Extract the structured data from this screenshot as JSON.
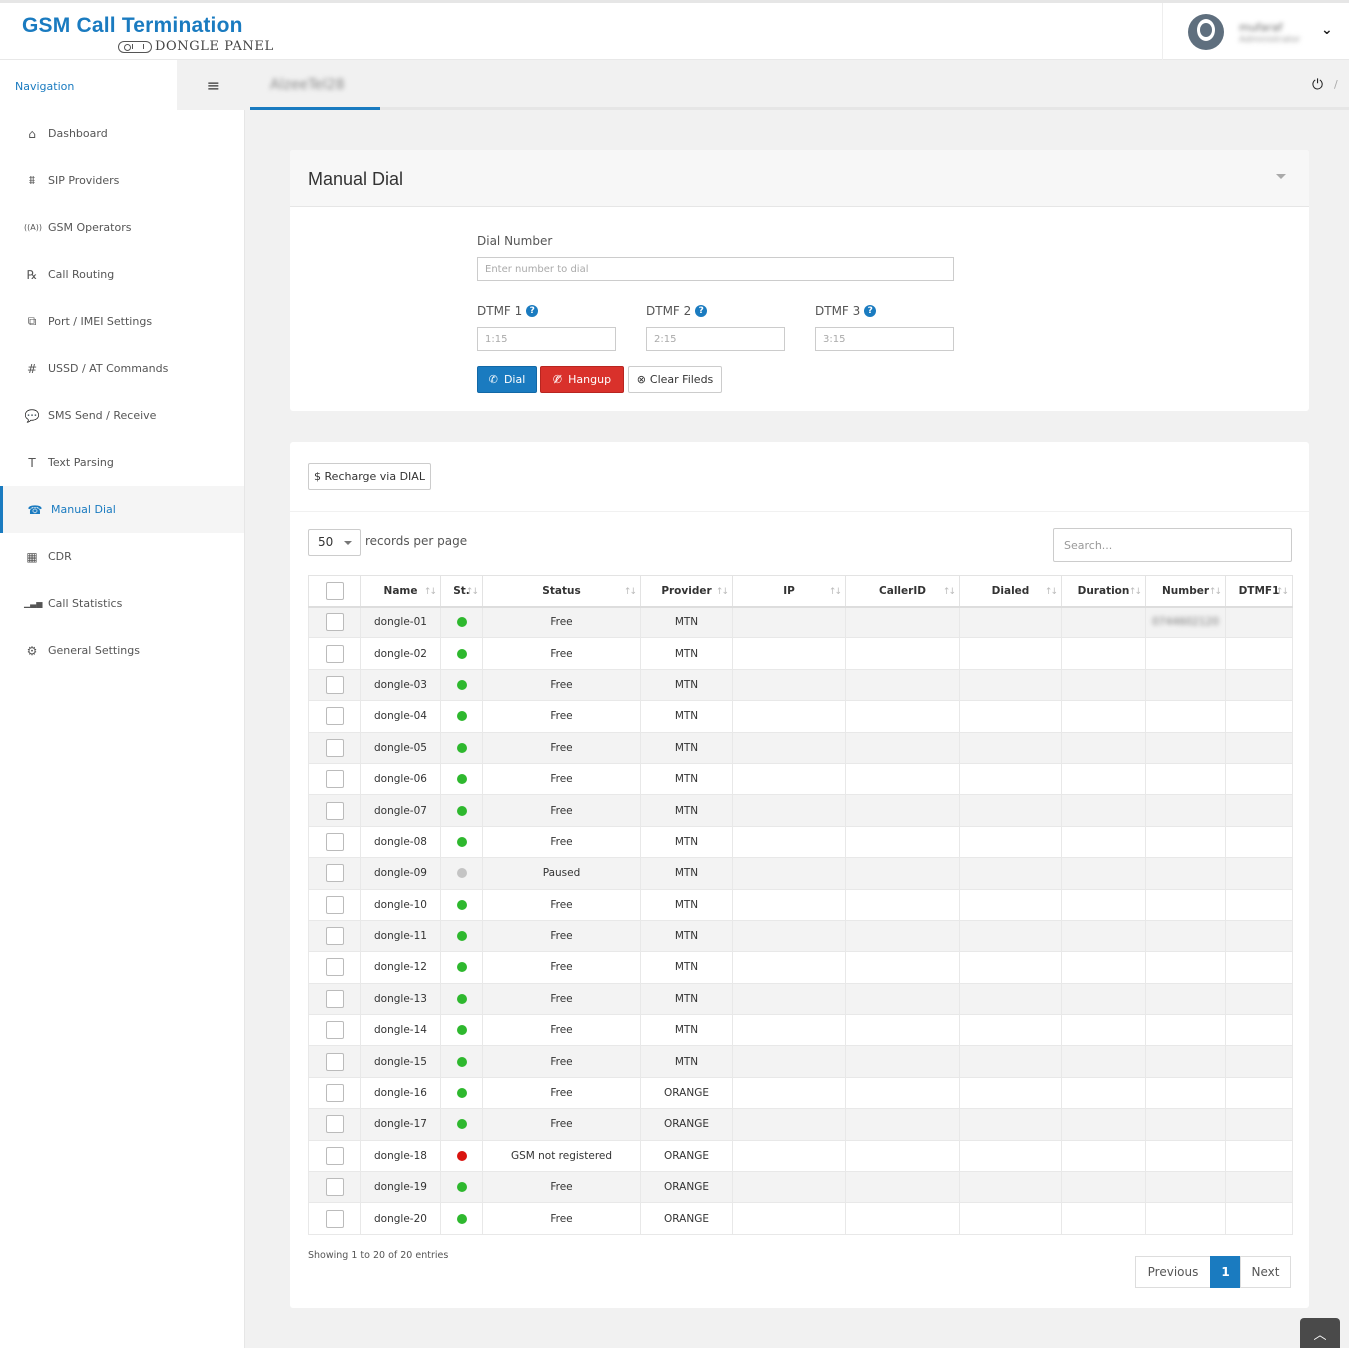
{
  "header": {
    "logo_title": "GSM Call Termination",
    "logo_sub": "DONGLE PANEL",
    "user_name": "mufaraf",
    "user_role": "Administrator",
    "caret_icon": "chevron-down-icon"
  },
  "nav": {
    "label": "Navigation",
    "toggle": "≡",
    "items": [
      {
        "label": "Dashboard",
        "icon": "⌂",
        "icon_name": "home-icon"
      },
      {
        "label": "SIP Providers",
        "icon": "⩩",
        "icon_name": "sitemap-icon"
      },
      {
        "label": "GSM Operators",
        "icon": "((A))",
        "icon_name": "antenna-icon"
      },
      {
        "label": "Call Routing",
        "icon": "℞",
        "icon_name": "prescription-icon"
      },
      {
        "label": "Port / IMEI Settings",
        "icon": "⧉",
        "icon_name": "network-icon"
      },
      {
        "label": "USSD / AT Commands",
        "icon": "#",
        "icon_name": "hash-icon"
      },
      {
        "label": "SMS Send / Receive",
        "icon": "💬",
        "icon_name": "sms-icon"
      },
      {
        "label": "Text Parsing",
        "icon": "T",
        "icon_name": "text-parse-icon"
      },
      {
        "label": "Manual Dial",
        "icon": "☎",
        "icon_name": "phone-square-icon"
      },
      {
        "label": "CDR",
        "icon": "▦",
        "icon_name": "table-icon"
      },
      {
        "label": "Call Statistics",
        "icon": "▁▃▅",
        "icon_name": "bar-chart-icon"
      },
      {
        "label": "General Settings",
        "icon": "⚙",
        "icon_name": "cogs-icon"
      }
    ]
  },
  "crumb": {
    "name": "AlzeeTel28",
    "separator": "/"
  },
  "manual_dial": {
    "title": "Manual Dial",
    "dial_label": "Dial Number",
    "dial_placeholder": "Enter number to dial",
    "dtmf1_label": "DTMF 1",
    "dtmf2_label": "DTMF 2",
    "dtmf3_label": "DTMF 3",
    "dtmf1_placeholder": "1:15",
    "dtmf2_placeholder": "2:15",
    "dtmf3_placeholder": "3:15",
    "dial_btn": "Dial",
    "hangup_btn": "Hangup",
    "clear_btn": "Clear Fileds"
  },
  "table_panel": {
    "recharge_btn": "$ Recharge via DIAL",
    "page_length": "50",
    "records_per_page": "records per page",
    "search_placeholder": "Search...",
    "columns": [
      "Name",
      "St.",
      "Status",
      "Provider",
      "IP",
      "CallerID",
      "Dialed",
      "Duration",
      "Number",
      "DTMF1"
    ],
    "rows": [
      {
        "name": "dongle-01",
        "st": "green",
        "status": "Free",
        "provider": "MTN",
        "number": "0744602120"
      },
      {
        "name": "dongle-02",
        "st": "green",
        "status": "Free",
        "provider": "MTN",
        "number": ""
      },
      {
        "name": "dongle-03",
        "st": "green",
        "status": "Free",
        "provider": "MTN",
        "number": ""
      },
      {
        "name": "dongle-04",
        "st": "green",
        "status": "Free",
        "provider": "MTN",
        "number": ""
      },
      {
        "name": "dongle-05",
        "st": "green",
        "status": "Free",
        "provider": "MTN",
        "number": ""
      },
      {
        "name": "dongle-06",
        "st": "green",
        "status": "Free",
        "provider": "MTN",
        "number": ""
      },
      {
        "name": "dongle-07",
        "st": "green",
        "status": "Free",
        "provider": "MTN",
        "number": ""
      },
      {
        "name": "dongle-08",
        "st": "green",
        "status": "Free",
        "provider": "MTN",
        "number": ""
      },
      {
        "name": "dongle-09",
        "st": "gray",
        "status": "Paused",
        "provider": "MTN",
        "number": ""
      },
      {
        "name": "dongle-10",
        "st": "green",
        "status": "Free",
        "provider": "MTN",
        "number": ""
      },
      {
        "name": "dongle-11",
        "st": "green",
        "status": "Free",
        "provider": "MTN",
        "number": ""
      },
      {
        "name": "dongle-12",
        "st": "green",
        "status": "Free",
        "provider": "MTN",
        "number": ""
      },
      {
        "name": "dongle-13",
        "st": "green",
        "status": "Free",
        "provider": "MTN",
        "number": ""
      },
      {
        "name": "dongle-14",
        "st": "green",
        "status": "Free",
        "provider": "MTN",
        "number": ""
      },
      {
        "name": "dongle-15",
        "st": "green",
        "status": "Free",
        "provider": "MTN",
        "number": ""
      },
      {
        "name": "dongle-16",
        "st": "green",
        "status": "Free",
        "provider": "ORANGE",
        "number": ""
      },
      {
        "name": "dongle-17",
        "st": "green",
        "status": "Free",
        "provider": "ORANGE",
        "number": ""
      },
      {
        "name": "dongle-18",
        "st": "red",
        "status": "GSM not registered",
        "provider": "ORANGE",
        "number": ""
      },
      {
        "name": "dongle-19",
        "st": "green",
        "status": "Free",
        "provider": "ORANGE",
        "number": ""
      },
      {
        "name": "dongle-20",
        "st": "green",
        "status": "Free",
        "provider": "ORANGE",
        "number": ""
      }
    ],
    "info": "Showing 1 to 20 of 20 entries",
    "prev": "Previous",
    "page": "1",
    "next": "Next"
  },
  "colors": {
    "accent": "#1a7bc0",
    "green": "#2eb82e",
    "gray": "#c4c4c4",
    "red": "#d9140f"
  }
}
